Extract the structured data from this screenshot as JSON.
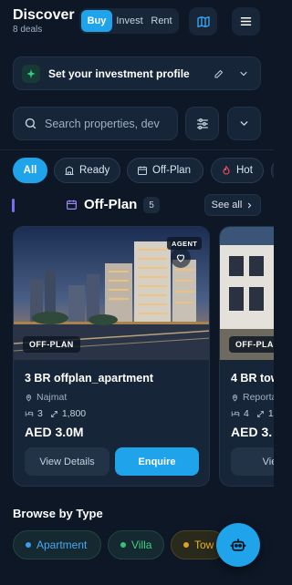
{
  "header": {
    "title": "Discover",
    "subtitle": "8 deals",
    "segments": [
      "Buy",
      "Invest",
      "Rent"
    ],
    "active_segment": "Buy",
    "icons": [
      "map-icon",
      "menu-icon"
    ]
  },
  "profile": {
    "label": "Set your investment profile",
    "icons": [
      "sparkle-icon",
      "edit-icon",
      "chevron-down-icon"
    ]
  },
  "search": {
    "placeholder": "Search properties, dev",
    "icons": [
      "search-icon",
      "filter-sliders-icon",
      "chevron-down-icon"
    ]
  },
  "chips": [
    {
      "label": "All",
      "active": true
    },
    {
      "label": "Ready",
      "icon": "building-icon"
    },
    {
      "label": "Off-Plan",
      "icon": "calendar-icon"
    },
    {
      "label": "Hot",
      "icon": "fire-icon"
    }
  ],
  "section": {
    "title": "Off-Plan",
    "count": "5",
    "see_all": "See all"
  },
  "cards": [
    {
      "title": "3 BR offplan_apartment",
      "location": "Najmat",
      "beds": "3",
      "area": "1,800",
      "price": "AED 3.0M",
      "tag": "OFF-PLAN",
      "agent_tag": "AGENT",
      "view_label": "View Details",
      "enquire_label": "Enquire"
    },
    {
      "title": "4 BR tow",
      "location": "Reporta",
      "beds": "4",
      "area": "1",
      "price": "AED 3.",
      "tag": "OFF-PLA",
      "view_label": "View"
    }
  ],
  "browse": {
    "title": "Browse by Type",
    "types": [
      {
        "label": "Apartment",
        "color": "#3b9cf0"
      },
      {
        "label": "Villa",
        "color": "#34c27a"
      },
      {
        "label": "Tow",
        "color": "#e0a020"
      }
    ]
  },
  "colors": {
    "background": "#0d1726",
    "accent": "#1fa3ea",
    "hot": "#f0505a",
    "section_bar": "#7c6cf0"
  }
}
